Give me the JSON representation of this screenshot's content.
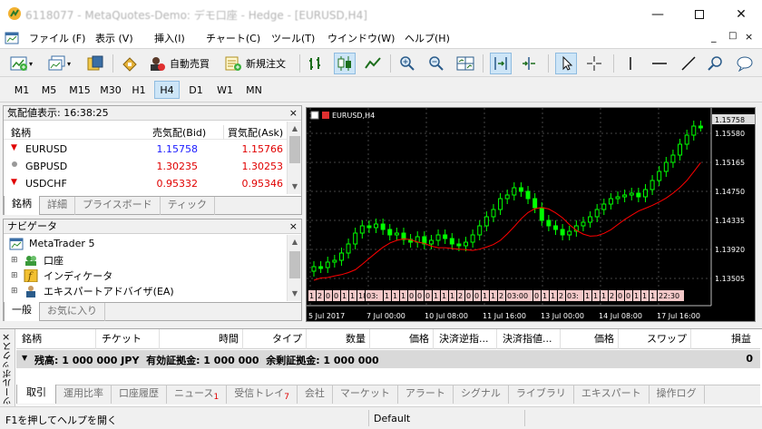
{
  "window": {
    "title": "6118077 - MetaQuotes-Demo: デモ口座 - Hedge - [EURUSD,H4]"
  },
  "menu": [
    {
      "label": "ファイル (F)"
    },
    {
      "label": "表示 (V)"
    },
    {
      "label": "挿入(I)"
    },
    {
      "label": "チャート(C)"
    },
    {
      "label": "ツール(T)"
    },
    {
      "label": "ウインドウ(W)"
    },
    {
      "label": "ヘルプ(H)"
    }
  ],
  "toolbar": {
    "auto_trading": "自動売買",
    "new_order": "新規注文"
  },
  "timeframes": [
    "M1",
    "M5",
    "M15",
    "M30",
    "H1",
    "H4",
    "D1",
    "W1",
    "MN"
  ],
  "active_timeframe": "H4",
  "market_watch": {
    "header": "気配値表示: 16:38:25",
    "col_symbol": "銘柄",
    "col_bid": "売気配(Bid)",
    "col_ask": "買気配(Ask)",
    "rows": [
      {
        "symbol": "EURUSD",
        "bid": "1.15758",
        "ask": "1.15766",
        "bid_color": "#1a1aff",
        "ask_color": "#e00000"
      },
      {
        "symbol": "GBPUSD",
        "bid": "1.30235",
        "ask": "1.30253",
        "bid_color": "#e00000",
        "ask_color": "#e00000"
      },
      {
        "symbol": "USDCHF",
        "bid": "0.95332",
        "ask": "0.95346",
        "bid_color": "#e00000",
        "ask_color": "#e00000"
      }
    ],
    "tabs": [
      "銘柄",
      "詳細",
      "プライスボード",
      "ティック"
    ]
  },
  "navigator": {
    "header": "ナビゲータ",
    "root": "MetaTrader 5",
    "items": [
      "口座",
      "インディケータ",
      "エキスパートアドバイザ(EA)"
    ],
    "tabs": [
      "一般",
      "お気に入り"
    ]
  },
  "chart": {
    "label": "EURUSD,H4",
    "price_labels": [
      "1.15580",
      "1.15165",
      "1.14750",
      "1.14335",
      "1.13920",
      "1.13505"
    ],
    "current_price": "1.15758",
    "time_labels": [
      "5 Jul 2017",
      "7 Jul 00:00",
      "10 Jul 08:00",
      "11 Jul 16:00",
      "13 Jul 00:00",
      "14 Jul 08:00",
      "17 Jul 16:00"
    ],
    "event_labels": [
      "1",
      "2",
      "0",
      "0",
      "1",
      "1",
      "18",
      "03:",
      "1",
      "1",
      "1",
      "0",
      "0",
      "0",
      "1",
      "1",
      "1",
      "2",
      "0",
      "0",
      "1",
      "1",
      "2",
      "03:00",
      "0",
      "1",
      "1",
      "2",
      "03:",
      "1",
      "1",
      "1",
      "2",
      "0",
      "0",
      "1",
      "1",
      "1",
      "22:30"
    ],
    "colors": {
      "bg": "#000000",
      "up": "#00ff00",
      "down": "#00ff00",
      "ma": "#ff0000",
      "grid": "#444444"
    }
  },
  "toolbox": {
    "side_label": "ツールボックス",
    "columns": [
      "銘柄",
      "チケット",
      "時間",
      "タイプ",
      "数量",
      "価格",
      "決済逆指...",
      "決済指値...",
      "価格",
      "スワップ",
      "損益"
    ],
    "balance_line": "残高: 1 000 000 JPY  有効証拠金: 1 000 000  余剰証拠金: 1 000 000",
    "profit": "0",
    "tabs": [
      {
        "label": "取引"
      },
      {
        "label": "運用比率"
      },
      {
        "label": "口座履歴"
      },
      {
        "label": "ニュース",
        "badge": "1"
      },
      {
        "label": "受信トレイ",
        "badge": "7"
      },
      {
        "label": "会社"
      },
      {
        "label": "マーケット"
      },
      {
        "label": "アラート"
      },
      {
        "label": "シグナル"
      },
      {
        "label": "ライブラリ"
      },
      {
        "label": "エキスパート"
      },
      {
        "label": "操作ログ"
      }
    ]
  },
  "status": {
    "help": "F1を押してヘルプを開く",
    "profile": "Default"
  }
}
